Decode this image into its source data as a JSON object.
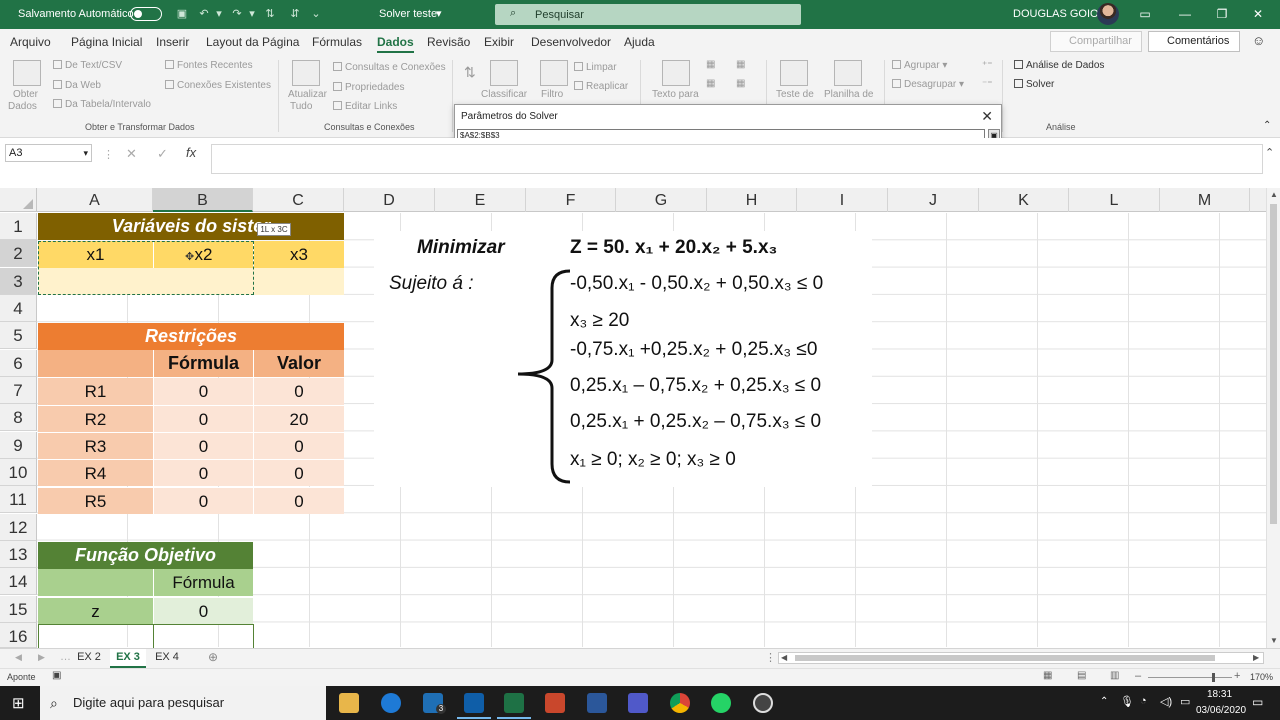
{
  "titlebar": {
    "autosave": "Salvamento Automático",
    "filename": "Solver teste",
    "search_placeholder": "Pesquisar",
    "user": "DOUGLAS GOIOS"
  },
  "menu": {
    "items": [
      "Arquivo",
      "Página Inicial",
      "Inserir",
      "Layout da Página",
      "Fórmulas",
      "Dados",
      "Revisão",
      "Exibir",
      "Desenvolvedor",
      "Ajuda"
    ],
    "active": "Dados",
    "share": "Compartilhar",
    "comments": "Comentários"
  },
  "ribbon": {
    "get_data": {
      "label1": "Obter",
      "label2": "Dados",
      "from_text": "De Text/CSV",
      "from_web": "Da Web",
      "from_table": "Da Tabela/Intervalo",
      "recent": "Fontes Recentes",
      "existing": "Conexões Existentes",
      "group": "Obter e Transformar Dados"
    },
    "queries": {
      "refresh1": "Atualizar",
      "refresh2": "Tudo",
      "queries": "Consultas e Conexões",
      "properties": "Propriedades",
      "edit_links": "Editar Links",
      "group": "Consultas e Conexões"
    },
    "sort": {
      "sort": "Classificar",
      "filter": "Filtro",
      "clear": "Limpar",
      "reapply": "Reaplicar"
    },
    "tools": {
      "text_to": "Texto para",
      "scenario": "Teste de",
      "forecast": "Planilha de",
      "group_btn": "Agrupar",
      "ungroup_btn": "Desagrupar"
    },
    "analysis": {
      "data_analysis": "Análise de Dados",
      "solver": "Solver",
      "group": "Análise"
    }
  },
  "dialog": {
    "title": "Parâmetros do Solver",
    "value": "$A$2:$B$3"
  },
  "namebox": "A3",
  "columns": [
    "A",
    "B",
    "C",
    "D",
    "E",
    "F",
    "G",
    "H",
    "I",
    "J",
    "K",
    "L",
    "M"
  ],
  "rows": [
    "1",
    "2",
    "3",
    "4",
    "5",
    "6",
    "7",
    "8",
    "9",
    "10",
    "11",
    "12",
    "13",
    "14",
    "15",
    "16"
  ],
  "sheet": {
    "vars_title": "Variáveis do sister",
    "size_tip": "1L x 3C",
    "vars": [
      "x1",
      "x2",
      "x3"
    ],
    "restr_title": "Restrições",
    "col_formula": "Fórmula",
    "col_value": "Valor",
    "restrictions": [
      {
        "name": "R1",
        "formula": "0",
        "value": "0"
      },
      {
        "name": "R2",
        "formula": "0",
        "value": "20"
      },
      {
        "name": "R3",
        "formula": "0",
        "value": "0"
      },
      {
        "name": "R4",
        "formula": "0",
        "value": "0"
      },
      {
        "name": "R5",
        "formula": "0",
        "value": "0"
      }
    ],
    "obj_title": "Função Objetivo",
    "obj_formula": "Fórmula",
    "obj_var": "z",
    "obj_value": "0"
  },
  "equations": {
    "minimize": "Minimizar",
    "subject": "Sujeito á :",
    "z": "Z = 50. x₁ + 20.x₂ + 5.x₃",
    "c1": "-0,50.x₁ - 0,50.x₂ + 0,50.x₃ ≤ 0",
    "c2": "x₃ ≥ 20",
    "c3": "-0,75.x₁ +0,25.x₂ + 0,25.x₃ ≤0",
    "c4": "0,25.x₁ – 0,75.x₂ + 0,25.x₃ ≤ 0",
    "c5": "0,25.x₁ + 0,25.x₂ – 0,75.x₃ ≤ 0",
    "c6": "x₁ ≥ 0; x₂ ≥ 0; x₃ ≥ 0"
  },
  "tabs": [
    "EX 2",
    "EX 3",
    "EX 4"
  ],
  "active_tab": "EX 3",
  "status": {
    "mode": "Aponte",
    "zoom": "170%"
  },
  "taskbar": {
    "search": "Digite aqui para pesquisar",
    "time": "18:31",
    "date": "03/06/2020",
    "outlook_badge": "3"
  },
  "colors": {
    "excel_green": "#217346",
    "vars_header": "#7f6000",
    "vars_row": "#ffd966",
    "vars_input": "#fff2cc",
    "restr_header": "#ed7d31",
    "restr_sub": "#f4b183",
    "restr_name": "#f8cbad",
    "restr_val": "#fce4d6",
    "obj_header": "#548235",
    "obj_sub": "#a9d08e",
    "obj_val": "#e2efda"
  }
}
